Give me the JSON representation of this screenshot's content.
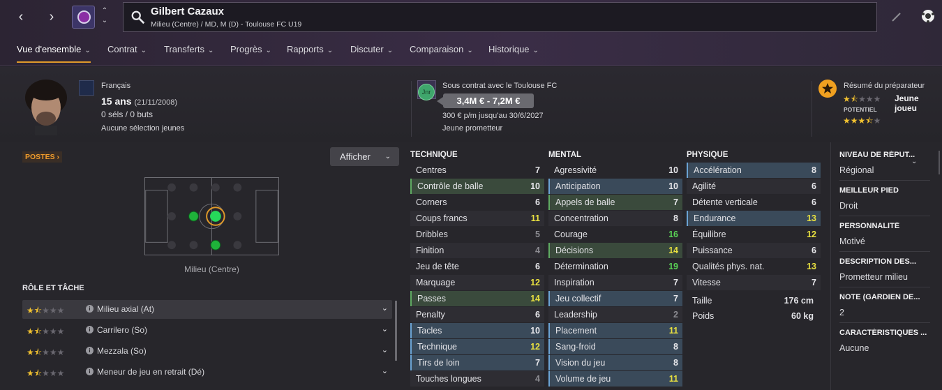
{
  "header": {
    "player_name": "Gilbert Cazaux",
    "player_subtitle": "Milieu (Centre) / MD, M (D) - Toulouse FC U19",
    "tabs": [
      {
        "label": "Vue d'ensemble",
        "active": true
      },
      {
        "label": "Contrat"
      },
      {
        "label": "Transferts"
      },
      {
        "label": "Progrès"
      },
      {
        "label": "Rapports"
      },
      {
        "label": "Discuter"
      },
      {
        "label": "Comparaison"
      },
      {
        "label": "Historique"
      }
    ],
    "icons": [
      "chevron-left-icon",
      "chevron-right-icon",
      "club-badge-icon",
      "up-down-icon",
      "search-icon",
      "pencil-icon",
      "football-icon"
    ]
  },
  "profile": {
    "nationality": "Français",
    "age": "15 ans",
    "birthdate": "(21/11/2008)",
    "caps": "0 séls / 0 buts",
    "youth": "Aucune sélection jeunes"
  },
  "contract": {
    "status": "Sous contrat avec le Toulouse FC",
    "badge": "Jnr",
    "value": "3,4M € - 7,2M €",
    "wage": "300 € p/m jusqu'au 30/6/2027",
    "type": "Jeune prometteur"
  },
  "coach": {
    "title": "Résumé du préparateur",
    "summary": "Jeune joueu",
    "potential_label": "POTENTIEL",
    "current_stars": 1.5,
    "potential_stars": 3.5
  },
  "positions": {
    "tag": "POSTES",
    "show_button": "Afficher",
    "position_label": "Milieu (Centre)"
  },
  "roles": {
    "title": "RÔLE ET TÂCHE",
    "items": [
      {
        "label": "Milieu axial (At)",
        "stars": 1.5,
        "selected": true
      },
      {
        "label": "Carrilero (So)",
        "stars": 1.5
      },
      {
        "label": "Mezzala (So)",
        "stars": 1.5
      },
      {
        "label": "Meneur de jeu en retrait (Dé)",
        "stars": 1.5
      }
    ]
  },
  "attributes": {
    "technique": {
      "title": "TECHNIQUE",
      "items": [
        {
          "name": "Centres",
          "value": "7"
        },
        {
          "name": "Contrôle de balle",
          "value": "10"
        },
        {
          "name": "Corners",
          "value": "6"
        },
        {
          "name": "Coups francs",
          "value": "11"
        },
        {
          "name": "Dribbles",
          "value": "5"
        },
        {
          "name": "Finition",
          "value": "4"
        },
        {
          "name": "Jeu de tête",
          "value": "6"
        },
        {
          "name": "Marquage",
          "value": "12"
        },
        {
          "name": "Passes",
          "value": "14"
        },
        {
          "name": "Penalty",
          "value": "6"
        },
        {
          "name": "Tacles",
          "value": "10"
        },
        {
          "name": "Technique",
          "value": "12"
        },
        {
          "name": "Tirs de loin",
          "value": "7"
        },
        {
          "name": "Touches longues",
          "value": "4"
        }
      ]
    },
    "mental": {
      "title": "MENTAL",
      "items": [
        {
          "name": "Agressivité",
          "value": "10"
        },
        {
          "name": "Anticipation",
          "value": "10"
        },
        {
          "name": "Appels de balle",
          "value": "7"
        },
        {
          "name": "Concentration",
          "value": "8"
        },
        {
          "name": "Courage",
          "value": "16"
        },
        {
          "name": "Décisions",
          "value": "14"
        },
        {
          "name": "Détermination",
          "value": "19"
        },
        {
          "name": "Inspiration",
          "value": "7"
        },
        {
          "name": "Jeu collectif",
          "value": "7"
        },
        {
          "name": "Leadership",
          "value": "2"
        },
        {
          "name": "Placement",
          "value": "11"
        },
        {
          "name": "Sang-froid",
          "value": "8"
        },
        {
          "name": "Vision du jeu",
          "value": "8"
        },
        {
          "name": "Volume de jeu",
          "value": "11"
        }
      ]
    },
    "physique": {
      "title": "PHYSIQUE",
      "items": [
        {
          "name": "Accélération",
          "value": "8"
        },
        {
          "name": "Agilité",
          "value": "6"
        },
        {
          "name": "Détente verticale",
          "value": "6"
        },
        {
          "name": "Endurance",
          "value": "13"
        },
        {
          "name": "Équilibre",
          "value": "12"
        },
        {
          "name": "Puissance",
          "value": "6"
        },
        {
          "name": "Qualités phys. nat.",
          "value": "13"
        },
        {
          "name": "Vitesse",
          "value": "7"
        }
      ]
    },
    "physical_info": [
      {
        "name": "Taille",
        "value": "176 cm"
      },
      {
        "name": "Poids",
        "value": "60 kg"
      }
    ]
  },
  "info_panel": [
    {
      "key": "NIVEAU DE RÉPUT...",
      "value": "Régional"
    },
    {
      "key": "MEILLEUR PIED",
      "value": "Droit"
    },
    {
      "key": "PERSONNALITÉ",
      "value": "Motivé"
    },
    {
      "key": "DESCRIPTION DES...",
      "value": "Prometteur milieu"
    },
    {
      "key": "NOTE (GARDIEN DE...",
      "value": "2"
    },
    {
      "key": "CARACTÉRISTIQUES ...",
      "value": "Aucune"
    }
  ],
  "colors": {
    "accent": "#e09a2a",
    "value_high": "#5ad456",
    "value_mid": "#e8e040",
    "value_low": "#8c8c92",
    "highlight_blue": "#3a4a5a",
    "highlight_green": "#3a4a3c"
  }
}
